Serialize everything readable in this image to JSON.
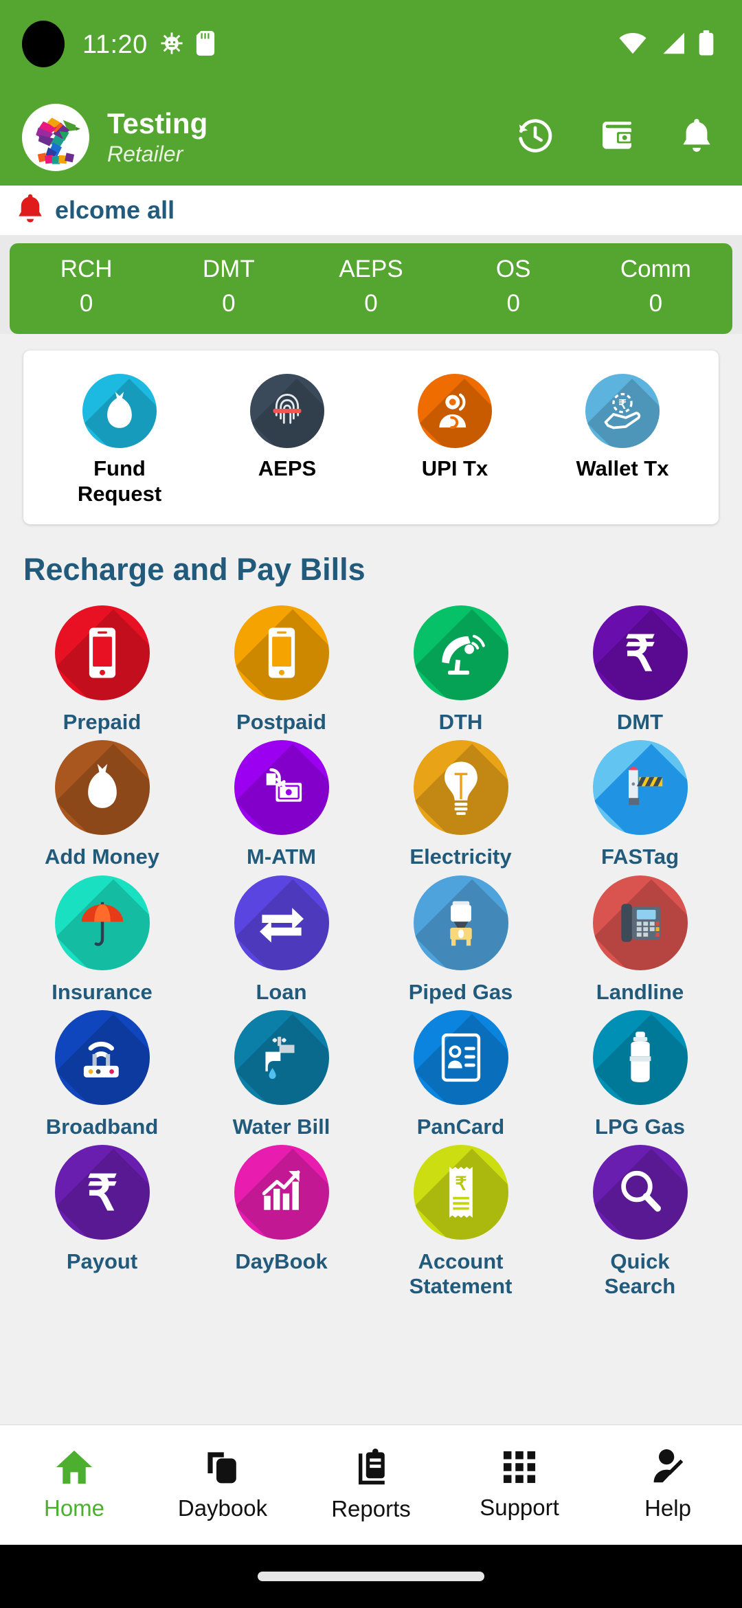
{
  "status_bar": {
    "time": "11:20",
    "left_icons": [
      "android-debug-icon",
      "sd-card-icon"
    ],
    "right_icons": [
      "wifi-icon",
      "signal-icon",
      "battery-icon"
    ]
  },
  "header": {
    "logo_name": "app-logo-bird",
    "user_name": "Testing",
    "user_role": "Retailer",
    "actions": [
      {
        "name": "history-icon",
        "label": "History"
      },
      {
        "name": "wallet-icon",
        "label": "Wallet"
      },
      {
        "name": "notification-bell-icon",
        "label": "Notifications"
      }
    ]
  },
  "marquee": {
    "icon": "alert-bell-icon",
    "text": "elcome all"
  },
  "stats": {
    "items": [
      {
        "label": "RCH",
        "value": "0"
      },
      {
        "label": "DMT",
        "value": "0"
      },
      {
        "label": "AEPS",
        "value": "0"
      },
      {
        "label": "OS",
        "value": "0"
      },
      {
        "label": "Comm",
        "value": "0"
      }
    ]
  },
  "quick_actions": [
    {
      "label": "Fund\nRequest",
      "label_line1": "Fund",
      "label_line2": "Request",
      "icon": "money-bag-icon",
      "color": "#1cb9e0"
    },
    {
      "label": "AEPS",
      "label_line1": "AEPS",
      "label_line2": "",
      "icon": "fingerprint-scan-icon",
      "color": "#3b4a5a"
    },
    {
      "label": "UPI Tx",
      "label_line1": "UPI Tx",
      "label_line2": "",
      "icon": "person-money-icon",
      "color": "#ef6c00"
    },
    {
      "label": "Wallet Tx",
      "label_line1": "Wallet Tx",
      "label_line2": "",
      "icon": "hand-rupee-icon",
      "color": "#5cb3dd"
    }
  ],
  "section": {
    "title": "Recharge and Pay Bills"
  },
  "services": [
    {
      "label": "Prepaid",
      "icon": "mobile-phone-icon",
      "color": "#e81123"
    },
    {
      "label": "Postpaid",
      "icon": "mobile-phone-icon",
      "color": "#f5a300"
    },
    {
      "label": "DTH",
      "icon": "satellite-dish-icon",
      "color": "#06c167"
    },
    {
      "label": "DMT",
      "icon": "rupee-icon",
      "color": "#6a0dad"
    },
    {
      "label": "Add Money",
      "icon": "money-bag-icon",
      "color": "#a9561f"
    },
    {
      "label": "M-ATM",
      "icon": "card-swipe-icon",
      "color": "#9b00f0"
    },
    {
      "label": "Electricity",
      "icon": "light-bulb-icon",
      "color": "#e8a317"
    },
    {
      "label": "FASTag",
      "icon": "toll-barrier-icon",
      "color": "#62c4f0"
    },
    {
      "label": "Insurance",
      "icon": "umbrella-icon",
      "color": "#18e0c0"
    },
    {
      "label": "Loan",
      "icon": "transfer-arrows-icon",
      "color": "#5b45e0"
    },
    {
      "label": "Piped Gas",
      "icon": "gas-stove-icon",
      "color": "#4fa3dd"
    },
    {
      "label": "Landline",
      "icon": "telephone-icon",
      "color": "#d9534f"
    },
    {
      "label": "Broadband",
      "icon": "wifi-router-icon",
      "color": "#1046bd"
    },
    {
      "label": "Water Bill",
      "icon": "water-tap-icon",
      "color": "#0b7fa8"
    },
    {
      "label": "PanCard",
      "icon": "id-card-icon",
      "color": "#0b84e0"
    },
    {
      "label": "LPG Gas",
      "icon": "gas-cylinder-icon",
      "color": "#0090b5"
    },
    {
      "label": "Payout",
      "icon": "rupee-icon",
      "color": "#6a1eb0"
    },
    {
      "label": "DayBook",
      "icon": "growth-chart-icon",
      "color": "#e81db0"
    },
    {
      "label": "Account Statement",
      "label_line1": "Account",
      "label_line2": "Statement",
      "icon": "receipt-rupee-icon",
      "color": "#ccdd12"
    },
    {
      "label": "Quick Search",
      "label_line1": "Quick",
      "label_line2": "Search",
      "icon": "magnifier-icon",
      "color": "#6a1eb0"
    }
  ],
  "bottom_nav": {
    "active_color": "#4caf2f",
    "items": [
      {
        "label": "Home",
        "icon": "home-icon",
        "active": true
      },
      {
        "label": "Daybook",
        "icon": "copy-pages-icon",
        "active": false
      },
      {
        "label": "Reports",
        "icon": "clipboard-icon",
        "active": false
      },
      {
        "label": "Support",
        "icon": "grid-dots-icon",
        "active": false
      },
      {
        "label": "Help",
        "icon": "person-edit-icon",
        "active": false
      }
    ]
  },
  "colors": {
    "brand_green": "#55a630",
    "heading_blue": "#225a7c",
    "label_blue": "#225a7c",
    "page_bg": "#f0f0f0"
  }
}
